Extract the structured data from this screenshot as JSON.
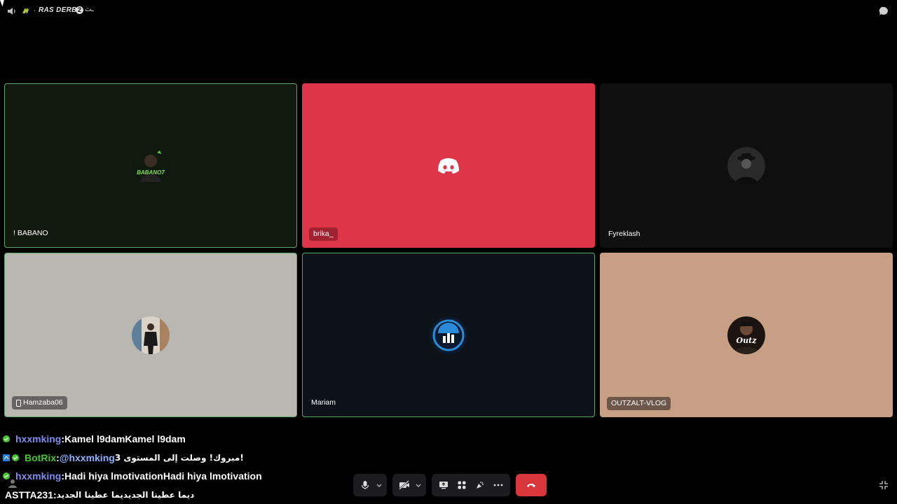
{
  "channel": {
    "name": "RAS DERB",
    "badge": "2",
    "suffix": "ـث"
  },
  "tiles": [
    {
      "name": "! BABANO",
      "bg": "#121a10",
      "speaking": true,
      "tag": "plain"
    },
    {
      "name": "brika_",
      "bg": "#de3548",
      "speaking": false,
      "tag": "red"
    },
    {
      "name": "Fyreklash",
      "bg": "#0f0f0f",
      "speaking": false,
      "tag": "plain"
    },
    {
      "name": "Hamzaba06",
      "bg": "#b9b7b2",
      "speaking": true,
      "tag": "dark",
      "mobile": true
    },
    {
      "name": "Mariam",
      "bg": "#0c1218",
      "speaking": true,
      "tag": "plain"
    },
    {
      "name": "OUTZALT-VLOG",
      "bg": "#c79f85",
      "speaking": false,
      "tag": "dark"
    }
  ],
  "avatars": {
    "babano": "BABANO7"
  },
  "chat": [
    {
      "user": "hxxmking",
      "color": "#7f8cf0",
      "sep": " : ",
      "text": "Kamel l9damKamel l9dam",
      "mention": ""
    },
    {
      "user": "BotRix",
      "color": "#46c72f",
      "sep": " : ",
      "mention": "@hxxmking",
      "text": " !مبروك! وصلت إلى المستوى 3"
    },
    {
      "user": "hxxmking",
      "color": "#7f8cf0",
      "sep": " : ",
      "text": "Hadi hiya lmotivationHadi hiya lmotivation",
      "mention": ""
    },
    {
      "user": "ASTTA231",
      "color": "#ffffff",
      "sep": " : ",
      "text": "ديما عطينا الجديديما عطينا الجديد",
      "mention": ""
    }
  ],
  "colors": {
    "accent": "#5aa66a",
    "hangup": "#da373c",
    "discord": "#de3548"
  }
}
